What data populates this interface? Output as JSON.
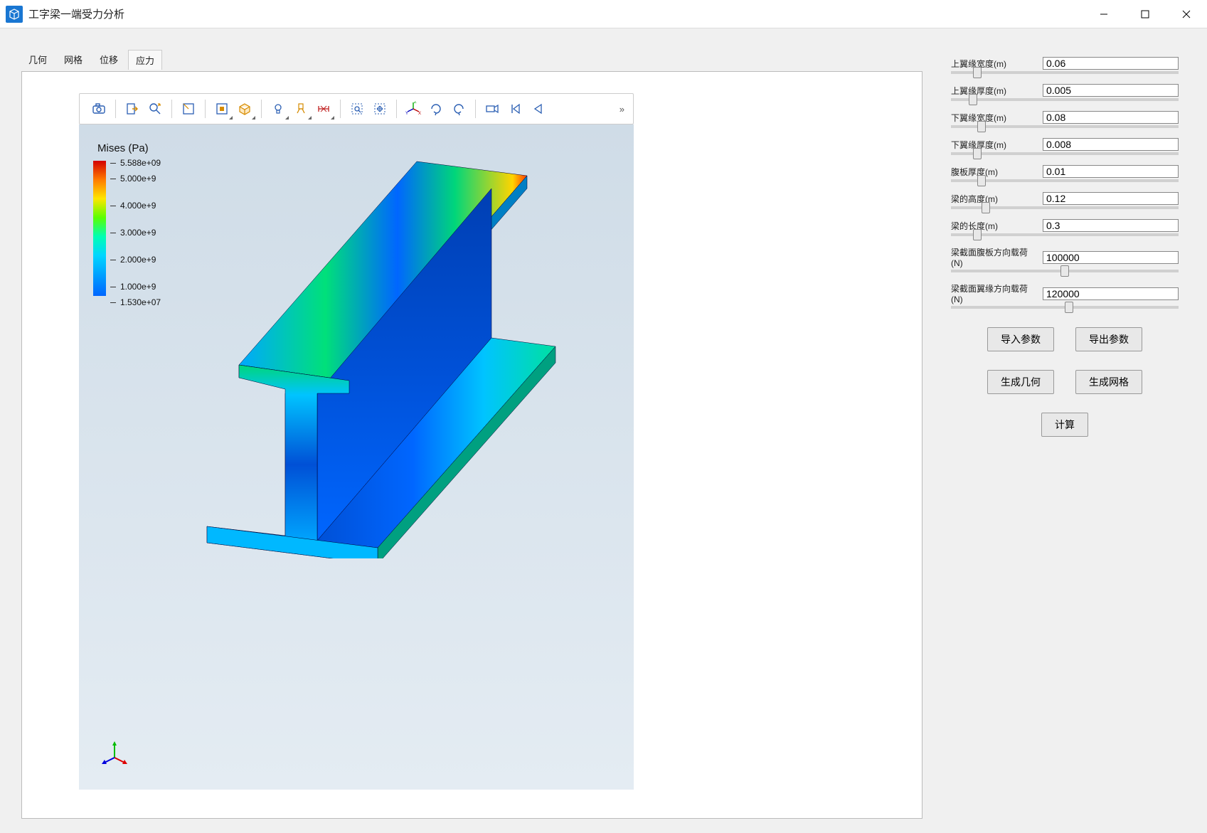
{
  "window": {
    "title": "工字梁一端受力分析"
  },
  "tabs": [
    "几何",
    "网格",
    "位移",
    "应力"
  ],
  "active_tab_index": 3,
  "toolbar_icons": [
    "camera",
    "export",
    "zoom-search",
    "select-box",
    "fit-screen",
    "isometric-view",
    "light",
    "brush",
    "dimension",
    "zoom-window",
    "pan-all",
    "axes-xyz",
    "rotate-cw",
    "rotate-ccw",
    "camera-record",
    "skip-start",
    "play-reverse"
  ],
  "legend": {
    "title": "Mises (Pa)",
    "ticks": [
      {
        "label": "5.588e+09",
        "pos": 0
      },
      {
        "label": "5.000e+9",
        "pos": 22
      },
      {
        "label": "4.000e+9",
        "pos": 60
      },
      {
        "label": "3.000e+9",
        "pos": 98
      },
      {
        "label": "2.000e+9",
        "pos": 136
      },
      {
        "label": "1.000e+9",
        "pos": 174
      },
      {
        "label": "1.530e+07",
        "pos": 196
      }
    ]
  },
  "params": [
    {
      "key": "top_flange_width",
      "label": "上翼缘宽度(m)",
      "value": "0.06",
      "slider": 10
    },
    {
      "key": "top_flange_thick",
      "label": "上翼缘厚度(m)",
      "value": "0.005",
      "slider": 8
    },
    {
      "key": "bot_flange_width",
      "label": "下翼缘宽度(m)",
      "value": "0.08",
      "slider": 12
    },
    {
      "key": "bot_flange_thick",
      "label": "下翼缘厚度(m)",
      "value": "0.008",
      "slider": 10
    },
    {
      "key": "web_thick",
      "label": "腹板厚度(m)",
      "value": "0.01",
      "slider": 12
    },
    {
      "key": "beam_height",
      "label": "梁的高度(m)",
      "value": "0.12",
      "slider": 14
    },
    {
      "key": "beam_length",
      "label": "梁的长度(m)",
      "value": "0.3",
      "slider": 10
    },
    {
      "key": "load_web",
      "label": "梁截面腹板方向载荷(N)",
      "value": "100000",
      "slider": 50
    },
    {
      "key": "load_flange",
      "label": "梁截面翼缘方向载荷(N)",
      "value": "120000",
      "slider": 52
    }
  ],
  "buttons": {
    "import": "导入参数",
    "export": "导出参数",
    "gen_geom": "生成几何",
    "gen_mesh": "生成网格",
    "compute": "计算"
  }
}
